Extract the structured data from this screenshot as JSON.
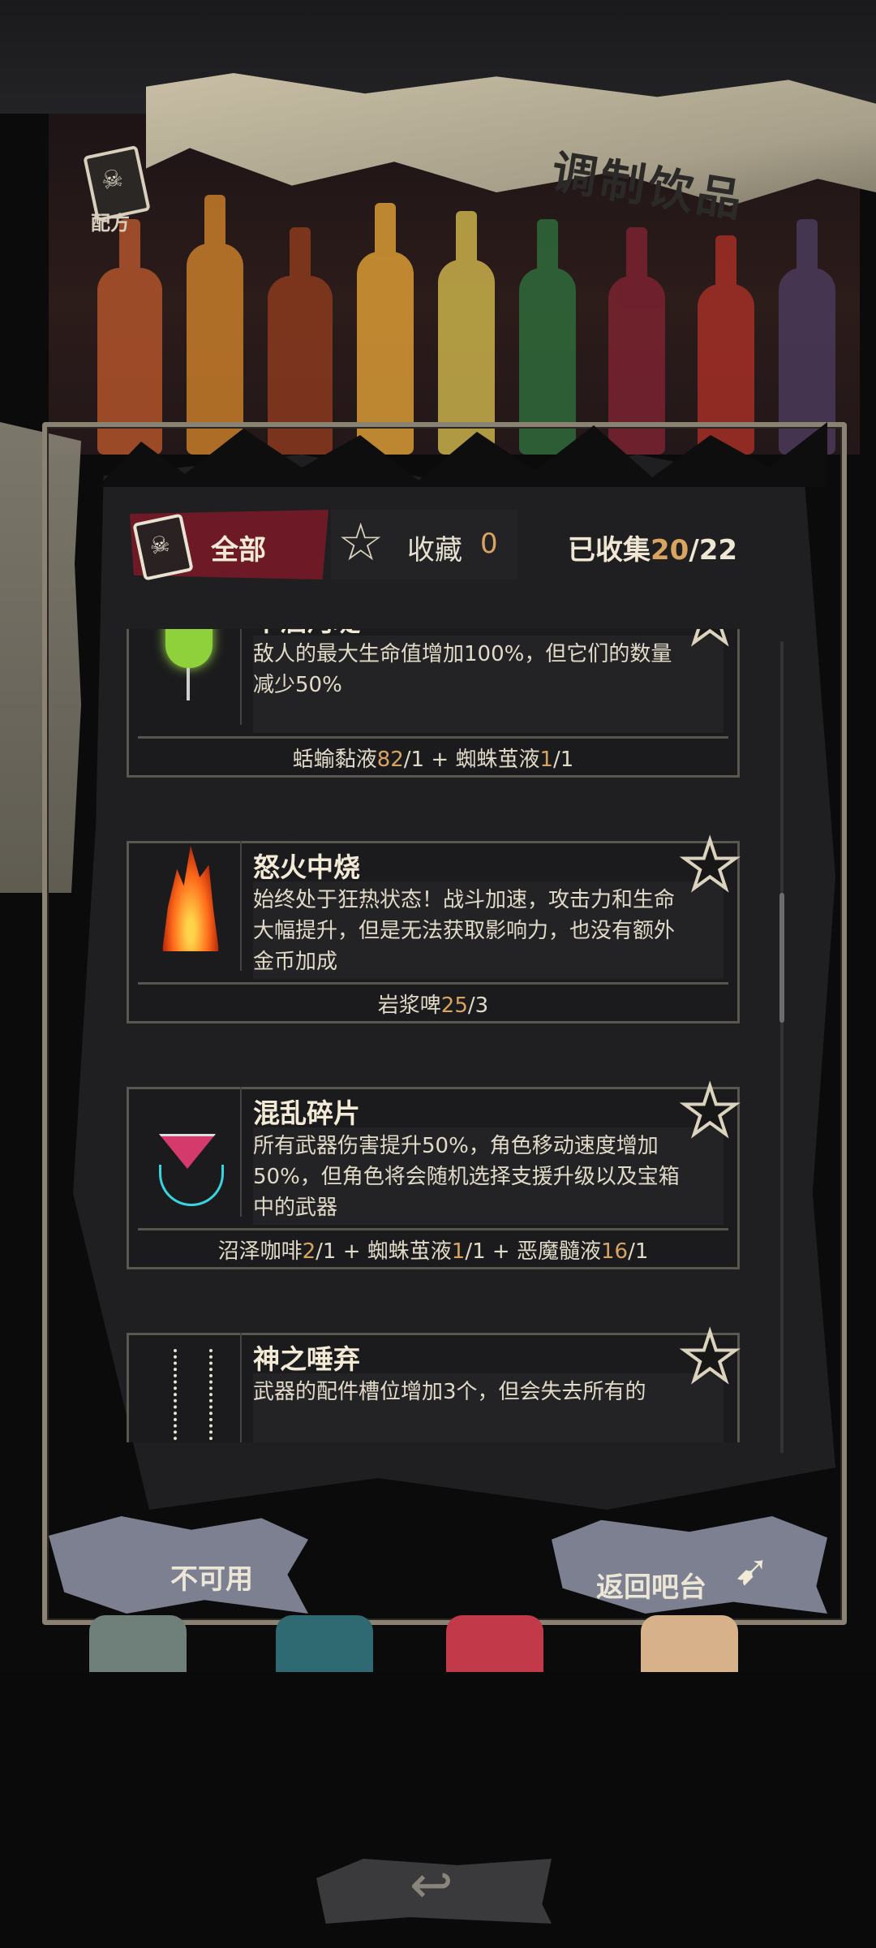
{
  "header": {
    "title": "调制饮品",
    "recipe_tab_label": "配方"
  },
  "filter": {
    "all_label": "全部",
    "favorites_label": "收藏",
    "favorites_count": "0",
    "collected_label": "已收集",
    "collected_count": "20",
    "collected_total": "/22"
  },
  "recipes": [
    {
      "name": "干涸河堤",
      "description": "敌人的最大生命值增加100%，但它们的数量减少50%",
      "ingredients": [
        {
          "name": "蛞蝓黏液",
          "have": "82",
          "need": "/1"
        },
        {
          "sep": " + "
        },
        {
          "name": "蜘蛛茧液",
          "have": "1",
          "need": "/1"
        }
      ],
      "icon": "green-cocktail-icon"
    },
    {
      "name": "怒火中烧",
      "description": "始终处于狂热状态！战斗加速，攻击力和生命大幅提升，但是无法获取影响力，也没有额外金币加成",
      "ingredients": [
        {
          "name": "岩浆啤",
          "have": "25",
          "need": "/3"
        }
      ],
      "icon": "fire-drink-icon"
    },
    {
      "name": "混乱碎片",
      "description": "所有武器伤害提升50%，角色移动速度增加50%，但角色将会随机选择支援升级以及宝箱中的武器",
      "ingredients": [
        {
          "name": "沼泽咖啡",
          "have": "2",
          "need": "/1"
        },
        {
          "sep": " + "
        },
        {
          "name": "蜘蛛茧液",
          "have": "1",
          "need": "/1"
        },
        {
          "sep": " + "
        },
        {
          "name": "恶魔髓液",
          "have": "16",
          "need": "/1"
        }
      ],
      "icon": "spider-cocktail-icon"
    },
    {
      "name": "神之唾弃",
      "description": "武器的配件槽位增加3个，但会失去所有的",
      "ingredients": [],
      "icon": "skeleton-drink-icon"
    }
  ],
  "buttons": {
    "unavailable": "不可用",
    "back_to_bar": "返回吧台"
  },
  "colors": {
    "accent_quantity": "#d9a460",
    "tab_active": "#6e1a26",
    "button": "#7c8090"
  }
}
